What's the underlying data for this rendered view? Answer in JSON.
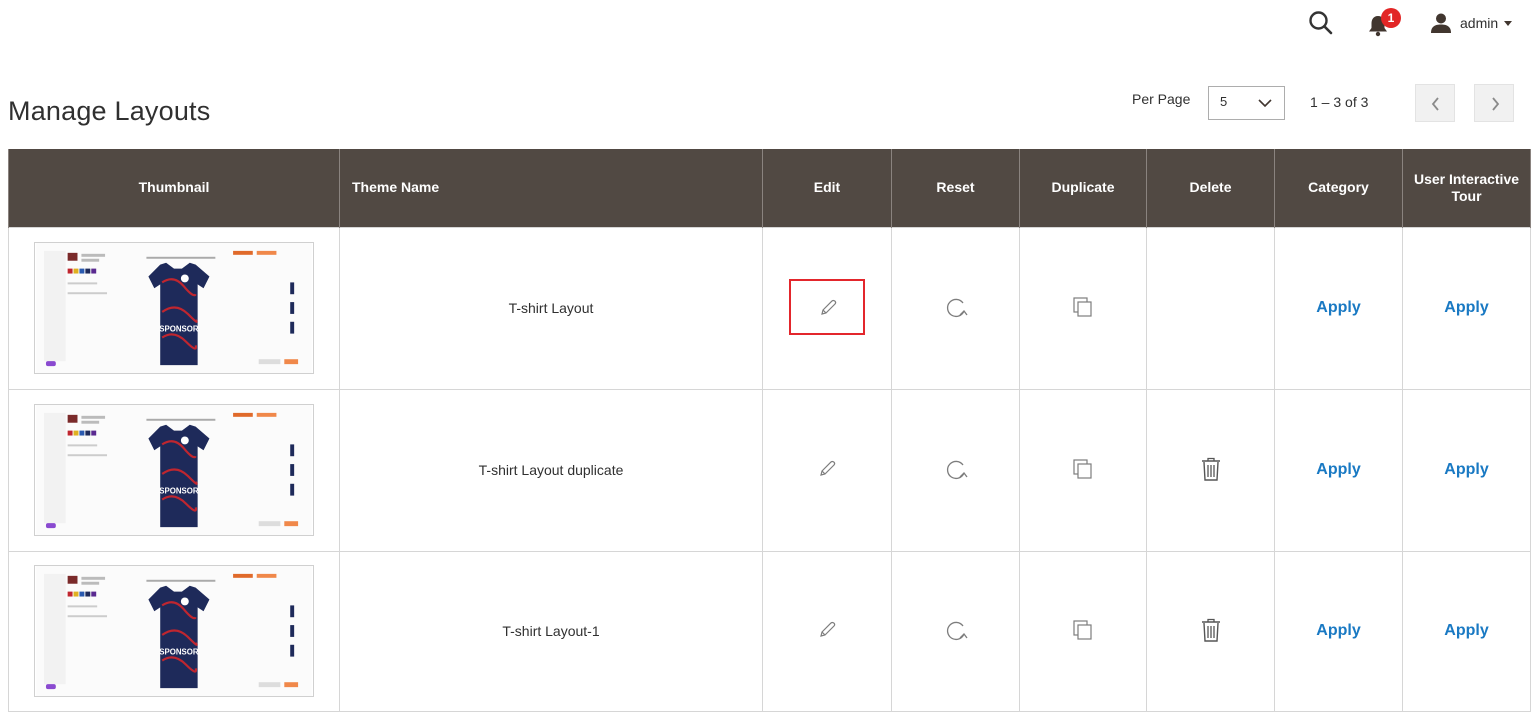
{
  "topbar": {
    "notification_count": "1",
    "user_name": "admin"
  },
  "page": {
    "title": "Manage Layouts"
  },
  "pagination": {
    "per_page_label": "Per Page",
    "per_page_value": "5",
    "range_text": "1 – 3 of 3"
  },
  "table": {
    "headers": {
      "thumbnail": "Thumbnail",
      "theme_name": "Theme Name",
      "edit": "Edit",
      "reset": "Reset",
      "duplicate": "Duplicate",
      "delete": "Delete",
      "category": "Category",
      "tour": "User Interactive Tour"
    },
    "rows": [
      {
        "theme_name": "T-shirt Layout",
        "category": "Apply",
        "tour": "Apply",
        "thumb_text": "SPONSOR"
      },
      {
        "theme_name": "T-shirt Layout duplicate",
        "category": "Apply",
        "tour": "Apply",
        "thumb_text": "SPONSOR"
      },
      {
        "theme_name": "T-shirt Layout-1",
        "category": "Apply",
        "tour": "Apply",
        "thumb_text": "SPONSOR"
      }
    ]
  },
  "colors": {
    "header_bg": "#514943",
    "link": "#1979c3",
    "badge": "#e22626",
    "highlight": "#e3262c",
    "jersey": "#1e2a5a",
    "jersey_pattern": "#c0262f"
  }
}
